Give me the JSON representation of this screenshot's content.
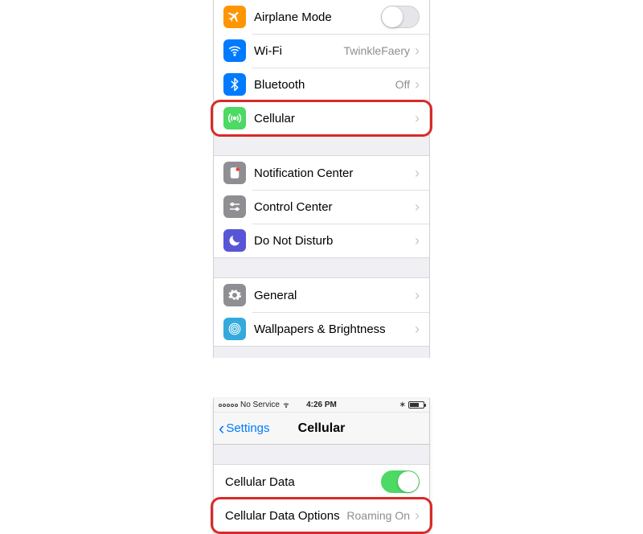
{
  "top": {
    "rows": {
      "airplane": {
        "label": "Airplane Mode",
        "icon_bg": "#ff9500"
      },
      "wifi": {
        "label": "Wi-Fi",
        "value": "TwinkleFaery",
        "icon_bg": "#007aff"
      },
      "bluetooth": {
        "label": "Bluetooth",
        "value": "Off",
        "icon_bg": "#007aff"
      },
      "cellular": {
        "label": "Cellular",
        "icon_bg": "#4cd964"
      },
      "notification": {
        "label": "Notification Center",
        "icon_bg": "#8e8e93"
      },
      "control": {
        "label": "Control Center",
        "icon_bg": "#8e8e93"
      },
      "dnd": {
        "label": "Do Not Disturb",
        "icon_bg": "#5856d6"
      },
      "general": {
        "label": "General",
        "icon_bg": "#8e8e93"
      },
      "wallpapers": {
        "label": "Wallpapers & Brightness",
        "icon_bg": "#34aadc"
      }
    }
  },
  "bottom": {
    "status": {
      "carrier": "No Service",
      "time": "4:26 PM"
    },
    "nav": {
      "back": "Settings",
      "title": "Cellular"
    },
    "rows": {
      "cellularData": {
        "label": "Cellular Data",
        "on": true
      },
      "cellularDataOptions": {
        "label": "Cellular Data Options",
        "value": "Roaming On"
      }
    }
  }
}
